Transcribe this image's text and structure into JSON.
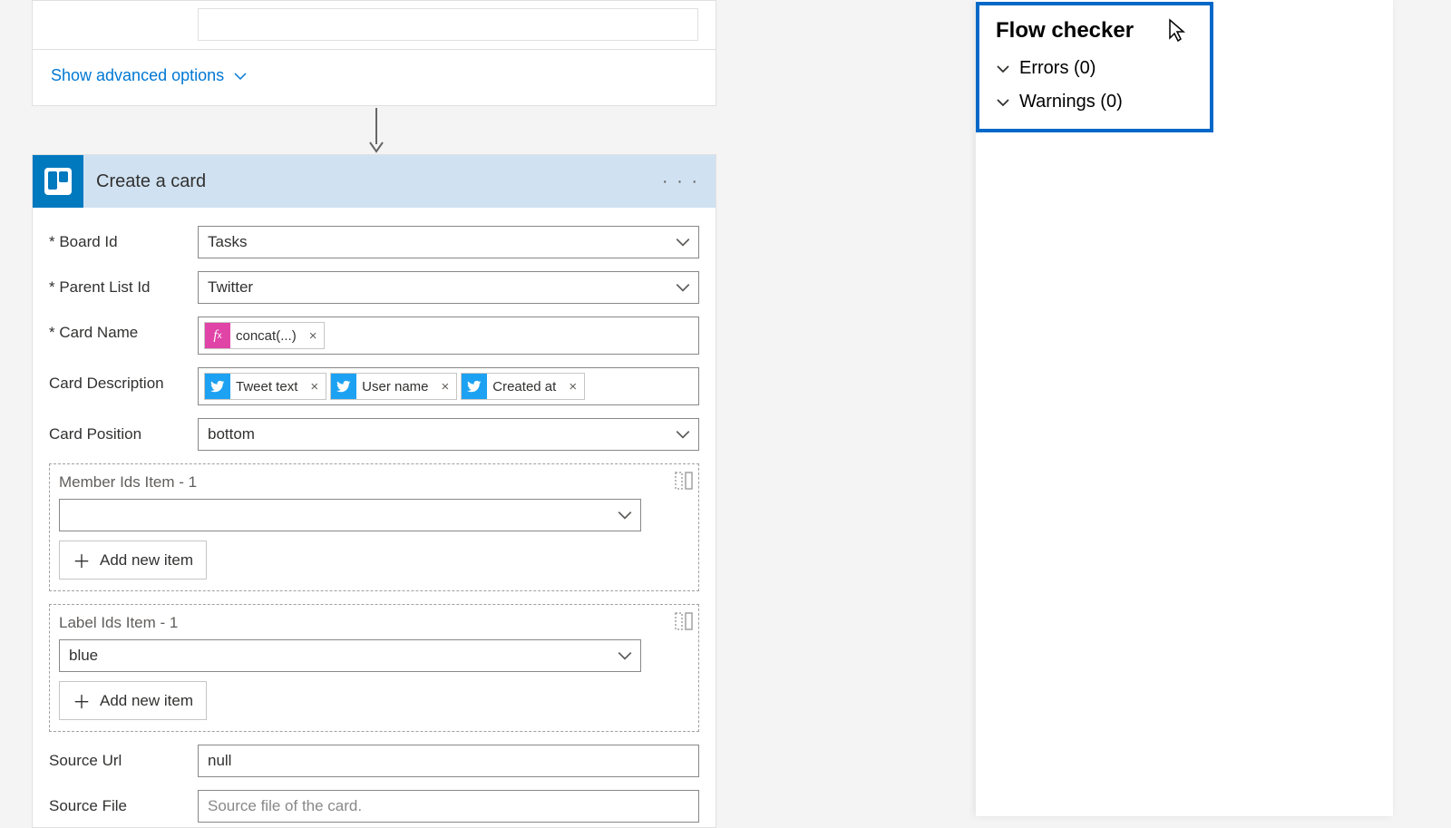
{
  "advanced": {
    "label": "Show advanced options"
  },
  "action": {
    "title": "Create a card",
    "fields": {
      "board_id": {
        "label": "Board Id",
        "value": "Tasks"
      },
      "parent_list_id": {
        "label": "Parent List Id",
        "value": "Twitter"
      },
      "card_name": {
        "label": "Card Name",
        "tokens": [
          {
            "kind": "fx",
            "label": "concat(...)"
          }
        ]
      },
      "card_description": {
        "label": "Card Description",
        "tokens": [
          {
            "kind": "tw",
            "label": "Tweet text"
          },
          {
            "kind": "tw",
            "label": "User name"
          },
          {
            "kind": "tw",
            "label": "Created at"
          }
        ]
      },
      "card_position": {
        "label": "Card Position",
        "value": "bottom"
      },
      "member_ids": {
        "section": "Member Ids Item - 1",
        "value": "",
        "add": "Add new item"
      },
      "label_ids": {
        "section": "Label Ids Item - 1",
        "value": "blue",
        "add": "Add new item"
      },
      "source_url": {
        "label": "Source Url",
        "value": "null"
      },
      "source_file": {
        "label": "Source File",
        "placeholder": "Source file of the card."
      }
    }
  },
  "flow_checker": {
    "title": "Flow checker",
    "errors": "Errors (0)",
    "warnings": "Warnings (0)"
  }
}
